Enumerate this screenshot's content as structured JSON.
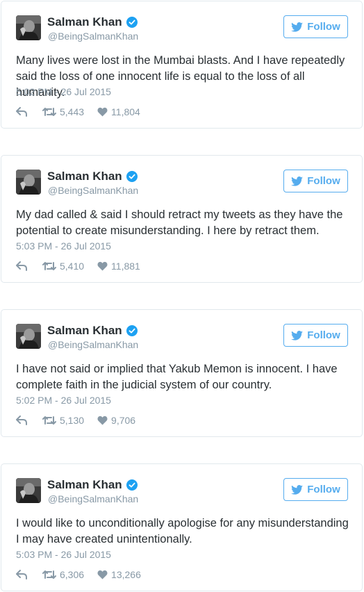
{
  "tweets": [
    {
      "name": "Salman Khan",
      "handle": "@BeingSalmanKhan",
      "follow_label": "Follow",
      "text": "Many lives were lost in the Mumbai blasts. And I have repeatedly said the loss of one innocent life is equal to the loss of all humanity.",
      "timestamp": "5:02 PM - 26 Jul 2015",
      "retweets": "5,443",
      "likes": "11,804"
    },
    {
      "name": "Salman Khan",
      "handle": "@BeingSalmanKhan",
      "follow_label": "Follow",
      "text": "My dad called & said I should retract my tweets as they have the potential to create misunderstanding. I here by retract them.",
      "timestamp": "5:03 PM - 26 Jul 2015",
      "retweets": "5,410",
      "likes": "11,881"
    },
    {
      "name": "Salman Khan",
      "handle": "@BeingSalmanKhan",
      "follow_label": "Follow",
      "text": "I have not said or implied that Yakub Memon is innocent. I have complete faith in the judicial system of our country.",
      "timestamp": "5:02 PM - 26 Jul 2015",
      "retweets": "5,130",
      "likes": "9,706"
    },
    {
      "name": "Salman Khan",
      "handle": "@BeingSalmanKhan",
      "follow_label": "Follow",
      "text": "I would like to unconditionally apologise for any misunderstanding I may have created unintentionally.",
      "timestamp": "5:03 PM - 26 Jul 2015",
      "retweets": "6,306",
      "likes": "13,266"
    }
  ],
  "colors": {
    "accent": "#55acee",
    "muted": "#8899a6",
    "text": "#292f33",
    "border": "#e1e8ed",
    "verified": "#1da1f2"
  },
  "icons": {
    "verified": "verified-badge-icon",
    "bird": "twitter-bird-icon",
    "reply": "reply-icon",
    "retweet": "retweet-icon",
    "like": "heart-icon",
    "avatar": "avatar-photo"
  }
}
